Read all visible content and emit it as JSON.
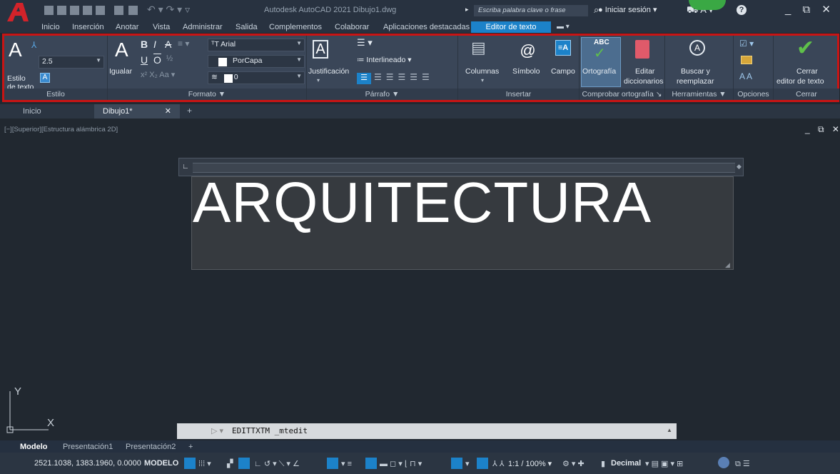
{
  "app": {
    "title": "Autodesk AutoCAD 2021  Dibujo1.dwg",
    "search_placeholder": "Escriba palabra clave o frase",
    "signin": "Iniciar sesión",
    "window_controls": "_ ⧉ ✕"
  },
  "menu": [
    "Inicio",
    "Inserción",
    "Anotar",
    "Vista",
    "Administrar",
    "Salida",
    "Complementos",
    "Colaborar",
    "Aplicaciones destacadas"
  ],
  "menu_active": "Editor de texto",
  "ribbon": {
    "estilo": {
      "height": "2.5",
      "label1": "Estilo",
      "label2": "de texto",
      "section": "Estilo"
    },
    "formato": {
      "match": "Igualar",
      "font": "Arial",
      "color": "PorCapa",
      "bg": "0",
      "section": "Formato ▼"
    },
    "parrafo": {
      "justify": "Justificación",
      "spacing": "Interlineado ▾",
      "section": "Párrafo ▼"
    },
    "insertar": {
      "columns": "Columnas",
      "symbol": "Símbolo",
      "field": "Campo",
      "section": "Insertar"
    },
    "ortografia": {
      "spell": "Ortografía",
      "abc": "ABC",
      "edit1": "Editar",
      "edit2": "diccionarios",
      "section": "Comprobar ortografía ↘"
    },
    "herramientas": {
      "find1": "Buscar y",
      "find2": "reemplazar",
      "section": "Herramientas ▼"
    },
    "opciones": {
      "section": "Opciones"
    },
    "cerrar": {
      "close1": "Cerrar",
      "close2": "editor de texto",
      "section": "Cerrar"
    }
  },
  "tabs": {
    "home": "Inicio",
    "drawing": "Dibujo1*",
    "close": "✕",
    "add": "+"
  },
  "viewport": {
    "label": "[−][Superior][Estructura alámbrica 2D]",
    "controls": "_ ⧉ ✕",
    "y_axis": "Y",
    "x_axis": "X"
  },
  "mtext": {
    "content": "ARQUITECTURA"
  },
  "command": {
    "text": "EDITTXTM _mtedit"
  },
  "layouts": {
    "model": "Modelo",
    "p1": "Presentación1",
    "p2": "Presentación2",
    "add": "+"
  },
  "status": {
    "coords": "2521.1038, 1383.1960, 0.0000",
    "mode": "MODELO",
    "scale": "1:1 / 100% ▾",
    "units": "Decimal"
  },
  "colors": {
    "accent": "#1c82c9",
    "highlight": "#c81414",
    "check": "#5fc14a"
  }
}
